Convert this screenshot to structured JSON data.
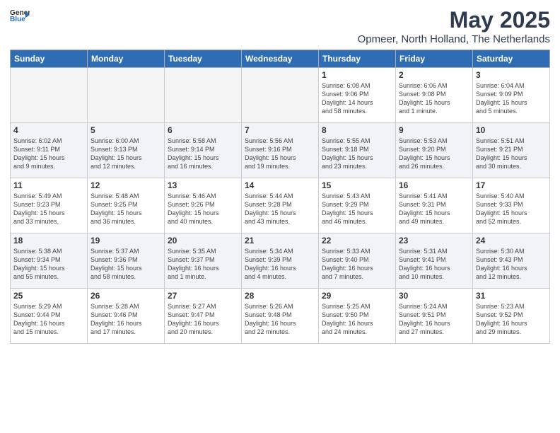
{
  "header": {
    "logo_general": "General",
    "logo_blue": "Blue",
    "main_title": "May 2025",
    "subtitle": "Opmeer, North Holland, The Netherlands"
  },
  "weekdays": [
    "Sunday",
    "Monday",
    "Tuesday",
    "Wednesday",
    "Thursday",
    "Friday",
    "Saturday"
  ],
  "rows": [
    {
      "cells": [
        {
          "day": "",
          "info": "",
          "empty": true
        },
        {
          "day": "",
          "info": "",
          "empty": true
        },
        {
          "day": "",
          "info": "",
          "empty": true
        },
        {
          "day": "",
          "info": "",
          "empty": true
        },
        {
          "day": "1",
          "info": "Sunrise: 6:08 AM\nSunset: 9:06 PM\nDaylight: 14 hours\nand 58 minutes."
        },
        {
          "day": "2",
          "info": "Sunrise: 6:06 AM\nSunset: 9:08 PM\nDaylight: 15 hours\nand 1 minute."
        },
        {
          "day": "3",
          "info": "Sunrise: 6:04 AM\nSunset: 9:09 PM\nDaylight: 15 hours\nand 5 minutes."
        }
      ]
    },
    {
      "cells": [
        {
          "day": "4",
          "info": "Sunrise: 6:02 AM\nSunset: 9:11 PM\nDaylight: 15 hours\nand 9 minutes."
        },
        {
          "day": "5",
          "info": "Sunrise: 6:00 AM\nSunset: 9:13 PM\nDaylight: 15 hours\nand 12 minutes."
        },
        {
          "day": "6",
          "info": "Sunrise: 5:58 AM\nSunset: 9:14 PM\nDaylight: 15 hours\nand 16 minutes."
        },
        {
          "day": "7",
          "info": "Sunrise: 5:56 AM\nSunset: 9:16 PM\nDaylight: 15 hours\nand 19 minutes."
        },
        {
          "day": "8",
          "info": "Sunrise: 5:55 AM\nSunset: 9:18 PM\nDaylight: 15 hours\nand 23 minutes."
        },
        {
          "day": "9",
          "info": "Sunrise: 5:53 AM\nSunset: 9:20 PM\nDaylight: 15 hours\nand 26 minutes."
        },
        {
          "day": "10",
          "info": "Sunrise: 5:51 AM\nSunset: 9:21 PM\nDaylight: 15 hours\nand 30 minutes."
        }
      ]
    },
    {
      "cells": [
        {
          "day": "11",
          "info": "Sunrise: 5:49 AM\nSunset: 9:23 PM\nDaylight: 15 hours\nand 33 minutes."
        },
        {
          "day": "12",
          "info": "Sunrise: 5:48 AM\nSunset: 9:25 PM\nDaylight: 15 hours\nand 36 minutes."
        },
        {
          "day": "13",
          "info": "Sunrise: 5:46 AM\nSunset: 9:26 PM\nDaylight: 15 hours\nand 40 minutes."
        },
        {
          "day": "14",
          "info": "Sunrise: 5:44 AM\nSunset: 9:28 PM\nDaylight: 15 hours\nand 43 minutes."
        },
        {
          "day": "15",
          "info": "Sunrise: 5:43 AM\nSunset: 9:29 PM\nDaylight: 15 hours\nand 46 minutes."
        },
        {
          "day": "16",
          "info": "Sunrise: 5:41 AM\nSunset: 9:31 PM\nDaylight: 15 hours\nand 49 minutes."
        },
        {
          "day": "17",
          "info": "Sunrise: 5:40 AM\nSunset: 9:33 PM\nDaylight: 15 hours\nand 52 minutes."
        }
      ]
    },
    {
      "cells": [
        {
          "day": "18",
          "info": "Sunrise: 5:38 AM\nSunset: 9:34 PM\nDaylight: 15 hours\nand 55 minutes."
        },
        {
          "day": "19",
          "info": "Sunrise: 5:37 AM\nSunset: 9:36 PM\nDaylight: 15 hours\nand 58 minutes."
        },
        {
          "day": "20",
          "info": "Sunrise: 5:35 AM\nSunset: 9:37 PM\nDaylight: 16 hours\nand 1 minute."
        },
        {
          "day": "21",
          "info": "Sunrise: 5:34 AM\nSunset: 9:39 PM\nDaylight: 16 hours\nand 4 minutes."
        },
        {
          "day": "22",
          "info": "Sunrise: 5:33 AM\nSunset: 9:40 PM\nDaylight: 16 hours\nand 7 minutes."
        },
        {
          "day": "23",
          "info": "Sunrise: 5:31 AM\nSunset: 9:41 PM\nDaylight: 16 hours\nand 10 minutes."
        },
        {
          "day": "24",
          "info": "Sunrise: 5:30 AM\nSunset: 9:43 PM\nDaylight: 16 hours\nand 12 minutes."
        }
      ]
    },
    {
      "cells": [
        {
          "day": "25",
          "info": "Sunrise: 5:29 AM\nSunset: 9:44 PM\nDaylight: 16 hours\nand 15 minutes."
        },
        {
          "day": "26",
          "info": "Sunrise: 5:28 AM\nSunset: 9:46 PM\nDaylight: 16 hours\nand 17 minutes."
        },
        {
          "day": "27",
          "info": "Sunrise: 5:27 AM\nSunset: 9:47 PM\nDaylight: 16 hours\nand 20 minutes."
        },
        {
          "day": "28",
          "info": "Sunrise: 5:26 AM\nSunset: 9:48 PM\nDaylight: 16 hours\nand 22 minutes."
        },
        {
          "day": "29",
          "info": "Sunrise: 5:25 AM\nSunset: 9:50 PM\nDaylight: 16 hours\nand 24 minutes."
        },
        {
          "day": "30",
          "info": "Sunrise: 5:24 AM\nSunset: 9:51 PM\nDaylight: 16 hours\nand 27 minutes."
        },
        {
          "day": "31",
          "info": "Sunrise: 5:23 AM\nSunset: 9:52 PM\nDaylight: 16 hours\nand 29 minutes."
        }
      ]
    }
  ]
}
